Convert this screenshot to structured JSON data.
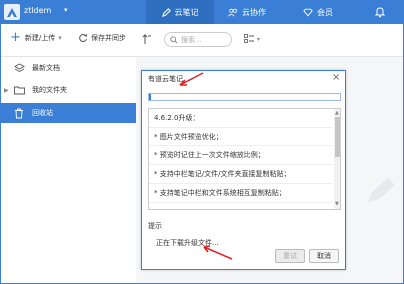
{
  "header": {
    "username": "ztldem",
    "tabs": [
      {
        "label": "云笔记"
      },
      {
        "label": "云协作"
      },
      {
        "label": "会员"
      }
    ]
  },
  "toolbar": {
    "new_upload": "新建/上传",
    "save_sync": "保存并同步",
    "search_placeholder": "搜索..."
  },
  "sidebar": {
    "items": [
      {
        "label": "最新文档"
      },
      {
        "label": "我的文件夹"
      },
      {
        "label": "回收站"
      }
    ]
  },
  "dialog": {
    "title": "有道云笔记",
    "progress": 0.01,
    "version_line": "4.6.2.0升级：",
    "items": [
      "* 图片文件预览优化；",
      "* 预览时记住上一次文件缩放比例；",
      "* 支持中栏笔记/文件/文件夹直接复制粘贴；",
      "* 支持笔记中栏和文件系统相互复制粘贴；"
    ],
    "tip_label": "提示",
    "tip_text": "正在下载升级文件...",
    "retry_label": "重试",
    "cancel_label": "取消"
  },
  "colors": {
    "accent": "#3a7fd5",
    "annotation_arrow": "#e02020"
  }
}
